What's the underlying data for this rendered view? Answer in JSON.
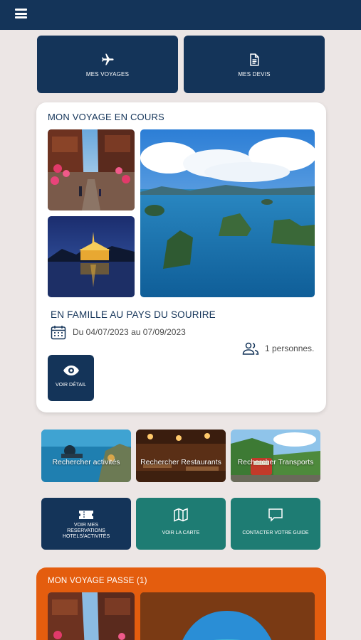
{
  "colors": {
    "navy": "#143459",
    "teal": "#1e7c73",
    "orange": "#e45d0e",
    "background": "#ece6e5"
  },
  "header": {
    "menu_icon": "hamburger-menu-icon"
  },
  "nav_tiles": [
    {
      "label": "MES VOYAGES",
      "icon": "airplane-icon"
    },
    {
      "label": "MES DEVIS",
      "icon": "document-icon"
    }
  ],
  "current_trip": {
    "section_title": "MON VOYAGE EN COURS",
    "name": "EN FAMILLE AU PAYS DU SOURIRE",
    "dates": "Du 04/07/2023 au 07/09/2023",
    "people": "1 personnes.",
    "detail_button": "VOIR DÉTAIL"
  },
  "search_tiles": [
    {
      "label": "Rechercher activités"
    },
    {
      "label": "Rechercher Restaurants"
    },
    {
      "label": "Rechercher Transports"
    }
  ],
  "action_tiles": [
    {
      "label": "VOIR MES RESERVATIONS HOTELS/ACTIVITÉS",
      "icon": "ticket-icon"
    },
    {
      "label": "VOIR LA CARTE",
      "icon": "map-icon"
    },
    {
      "label": "CONTACTER VOTRE GUIDE",
      "icon": "chat-icon"
    }
  ],
  "past_trip": {
    "section_title": "MON VOYAGE PASSE (1)"
  }
}
